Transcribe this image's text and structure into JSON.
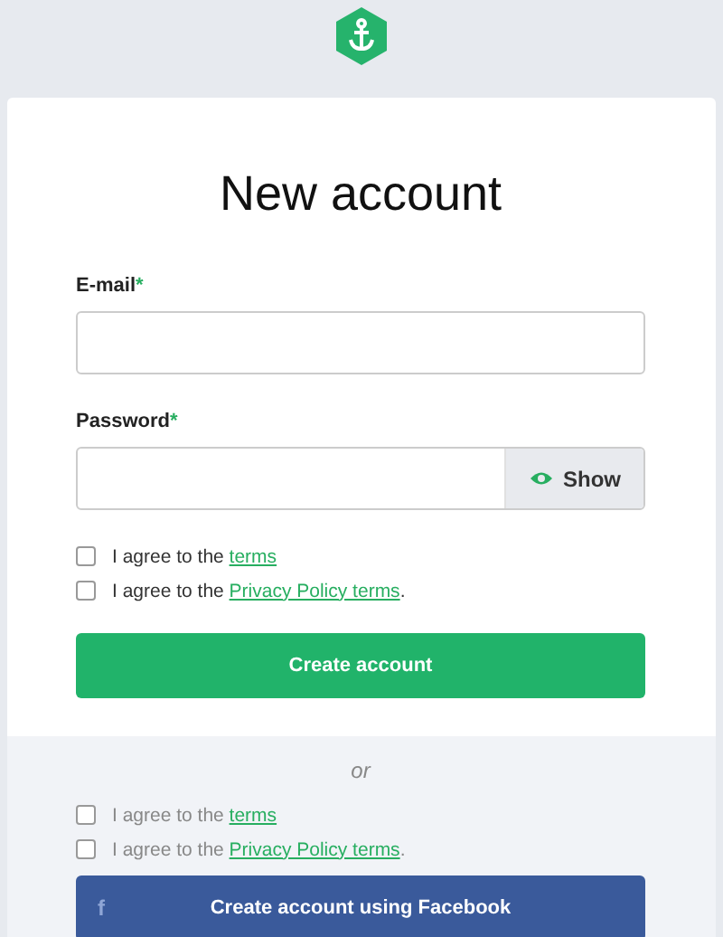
{
  "title": "New account",
  "email": {
    "label": "E-mail",
    "required_mark": "*"
  },
  "password": {
    "label": "Password",
    "required_mark": "*",
    "toggle": "Show"
  },
  "agreements": [
    {
      "prefix": "I agree to the ",
      "link": "terms",
      "checked": false
    },
    {
      "prefix": "I agree to the ",
      "link": "Privacy Policy terms",
      "suffix": ".",
      "checked": false
    }
  ],
  "submit_button": "Create account",
  "separator": "or",
  "social_agreements": [
    {
      "prefix": "I agree to the ",
      "link": "terms",
      "checked": false
    },
    {
      "prefix": "I agree to the ",
      "link": "Privacy Policy terms",
      "suffix": ".",
      "checked": false
    }
  ],
  "facebook_button": {
    "icon": "f",
    "label": "Create account using Facebook"
  }
}
